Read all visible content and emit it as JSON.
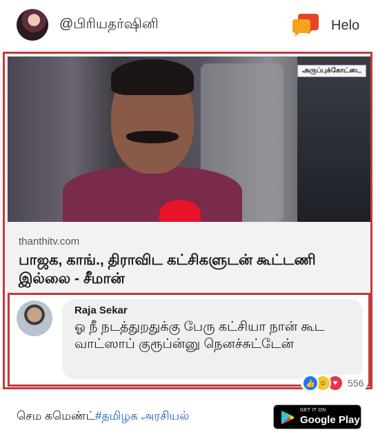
{
  "header": {
    "username": "@பிரியதர்ஷினி",
    "app_icon": "helo-chat-bubble-icon",
    "app_label": "Helo"
  },
  "post": {
    "photo_tag": "அருப்புக்கோட்டை",
    "source": "thanthitv.com",
    "headline": "பாஜக, காங்., திராவிட கட்சிகளுடன் கூட்டணி இல்லை - சீமான்"
  },
  "comment": {
    "author": "Raja Sekar",
    "text": "ஓ நீ நடத்துறதுக்கு பேரு கட்சியா நான் கூட வாட்ஸாப் குரூப்ன்னு நெனச்சுட்டேன்",
    "reaction_icons": [
      "like-icon",
      "haha-icon",
      "love-icon"
    ],
    "reaction_count": "556"
  },
  "footer": {
    "text": "செம கமெண்ட்",
    "hashtag": "#தமிழக அரசியல்",
    "badge_small": "GET IT ON",
    "badge_big": "Google Play"
  },
  "colors": {
    "frame": "#c33a3a",
    "hashtag": "#1f5fb5",
    "helo_orange": "#f26a1b"
  }
}
